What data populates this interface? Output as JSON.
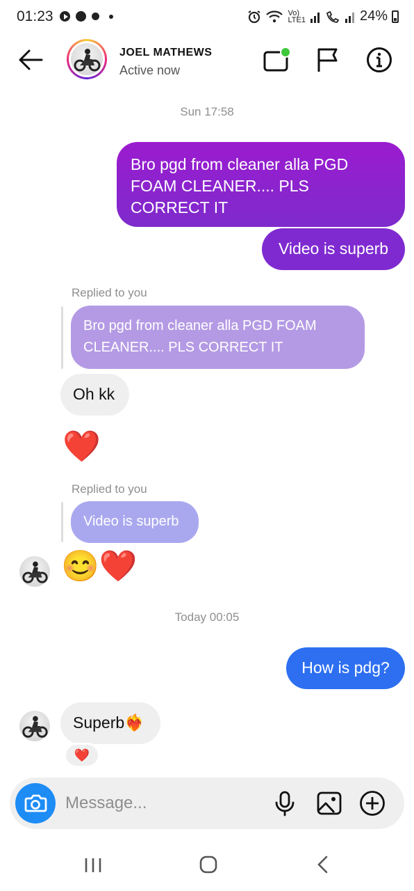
{
  "status_bar": {
    "time": "01:23",
    "volte": "Vo)",
    "lte": "LTE1",
    "battery": "24%"
  },
  "header": {
    "contact_name": "JOEL MATHEWS",
    "contact_status": "Active now",
    "online_color": "#3ec83a"
  },
  "messages": {
    "timestamp_1": "Sun 17:58",
    "out_1": "Bro pgd from cleaner alla PGD FOAM CLEANER.... PLS CORRECT IT",
    "out_2": "Video is superb",
    "reply_label_1": "Replied to you",
    "reply_quote_1": "Bro pgd from cleaner alla PGD FOAM CLEANER.... PLS CORRECT IT",
    "in_1": "Oh kk",
    "in_emoji_1": "❤️",
    "reply_label_2": "Replied to you",
    "reply_quote_2": "Video is superb",
    "in_emoji_2": "😊❤️",
    "timestamp_2": "Today 00:05",
    "out_3": "How is pdg?",
    "in_2": "Superb❤️‍🔥",
    "reaction": "❤️"
  },
  "composer": {
    "placeholder": "Message..."
  },
  "colors": {
    "accent_purple": "#8a22cf",
    "reply_purple": "#b49ae4",
    "reply_lavender": "#a9a8ef",
    "accent_blue": "#2d6ff0",
    "camera_blue": "#1e8cf5"
  }
}
